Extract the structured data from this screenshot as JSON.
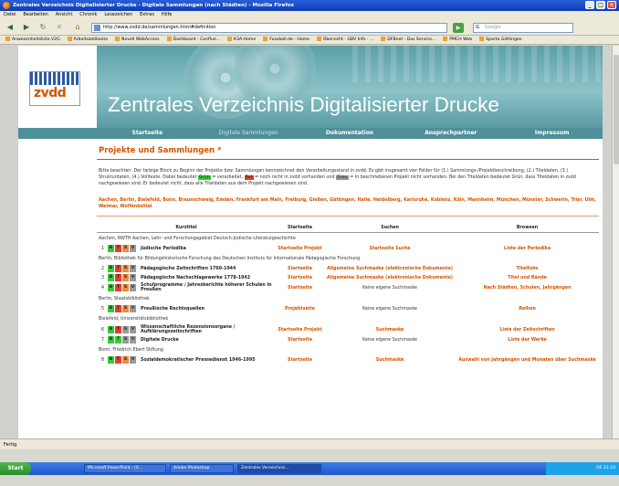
{
  "window": {
    "title": "Zentrales Verzeichnis Digitalisierter Drucke - Digitale Sammlungen (nach Städten) - Mozilla Firefox"
  },
  "menu": [
    "Datei",
    "Bearbeiten",
    "Ansicht",
    "Chronik",
    "Lesezeichen",
    "Extras",
    "Hilfe"
  ],
  "url": "http://www.zvdd.de/sammlungen.html#definition",
  "search_placeholder": "Google",
  "bookmarks": [
    "Anwesenheitsliste V2G",
    "Arbeitszeitkonto",
    "Novell WebAccess",
    "Dashboard - Conflue...",
    "K3A-Home",
    "Fussball.de - Home",
    "Übersicht - GBV Info - ...",
    "DFBnet - Das Service...",
    "PMCH Web",
    "Sparta Göttingen"
  ],
  "logo_text": "zvdd",
  "banner_title": "Zentrales Verzeichnis Digitalisierter Drucke",
  "sitenav": [
    "Startseite",
    "Digitale Sammlungen",
    "Dokumentation",
    "Ansprechpartner",
    "Impressum"
  ],
  "heading": "Projekte und Sammlungen *",
  "intro": {
    "p1": "Bitte beachten: Der farbige Block zu Beginn der Projekte bzw. Sammlungen kennzeichnet den Verarbeitungsstand in zvdd. Es gibt insgesamt vier Felder für (1.) Sammlungs-/Projektbeschreibung, (2.) Titeldaten, (3.) Strukturdaten, (4.) Volltexte. Dabei bedeutet ",
    "green": "Grün",
    "p2": " = verarbeitet, ",
    "red": "Rot",
    "p3": " = noch nicht in zvdd vorhanden und ",
    "gray": "Grau",
    "p4": " = in beschriebenen Projekt nicht vorhanden. Bei den Titeldaten bedeutet Grün, dass Titeldaten in zvdd nachgewiesen sind. Er bedeutet nicht, dass alle Titeldaten aus dem Projekt nachgewiesen sind."
  },
  "cities": "Aachen, Berlin, Bielefeld, Bonn, Braunschweig, Emden, Frankfurt am Main, Freiburg, Gießen, Göttingen, Halle, Heidelberg, Karlsruhe, Koblenz, Köln, Mannheim, München, Münster, Schwerin, Trier, Ulm, Weimar, Wolfenbüttel",
  "table": {
    "headers": [
      "Kurztitel",
      "Startseite",
      "Suchen",
      "Browsen"
    ],
    "groups": [
      {
        "label": "Aachen, RWTH Aachen, Lehr- und Forschungsgebiet Deutsch-Jüdische Literaturgeschichte",
        "rows": [
          {
            "n": "1",
            "flags": [
              "g",
              "r",
              "o",
              "gr"
            ],
            "title": "Jüdische Periodika",
            "start": "Startseite Projekt",
            "search": "Startseite Suche",
            "browse": "Liste der Periodika",
            "search_plain": false
          }
        ]
      },
      {
        "label": "Berlin, Bibliothek für Bildungshistorische Forschung des Deutschen Instituts für Internationale Pädagogische Forschung",
        "rows": [
          {
            "n": "2",
            "flags": [
              "g",
              "r",
              "o",
              "gr"
            ],
            "title": "Pädagogische Zeitschriften 1760-1944",
            "start": "Startseite",
            "search": "Allgemeine Suchmaske (elektronische Dokumente)",
            "browse": "Titelliste",
            "search_plain": false
          },
          {
            "n": "3",
            "flags": [
              "g",
              "r",
              "o",
              "gr"
            ],
            "title": "Pädagogische Nachschlagewerke 1778-1942",
            "start": "Startseite",
            "search": "Allgemeine Suchmaske (elektronische Dokumente)",
            "browse": "Titel und Bände",
            "search_plain": false
          },
          {
            "n": "4",
            "flags": [
              "g",
              "r",
              "o",
              "gr"
            ],
            "title": "Schulprogramme / Jahresberichte höherer Schulen in Preußen",
            "start": "Startseite",
            "search": "Keine eigene Suchmaske",
            "browse": "Nach Städten, Schulen, Jahrgängen",
            "search_plain": true
          }
        ]
      },
      {
        "label": "Berlin, Staatsbibliothek",
        "rows": [
          {
            "n": "5",
            "flags": [
              "g",
              "r",
              "o",
              "gr"
            ],
            "title": "Preußische Rechtsquellen",
            "start": "Projektseite",
            "search": "Keine eigene Suchmaske",
            "browse": "Reihen",
            "search_plain": true
          }
        ]
      },
      {
        "label": "Bielefeld, Universitätsbibliothek",
        "rows": [
          {
            "n": "6",
            "flags": [
              "g",
              "r",
              "gr",
              "gr"
            ],
            "title": "Wissenschaftliche Rezensionsorgane / Aufklärungszeitschriften",
            "start": "Startseite Projekt",
            "search": "Suchmaske",
            "browse": "Liste der Zeitschriften",
            "search_plain": false
          },
          {
            "n": "7",
            "flags": [
              "g",
              "g",
              "gr",
              "gr"
            ],
            "title": "Digitale Drucke",
            "start": "Startseite",
            "search": "Keine eigene Suchmaske",
            "browse": "Liste der Werke",
            "search_plain": true
          }
        ]
      },
      {
        "label": "Bonn, Friedrich Ebert Stiftung",
        "rows": [
          {
            "n": "8",
            "flags": [
              "g",
              "r",
              "o",
              "gr"
            ],
            "title": "Sozialdemokratischer Pressedienst 1946-1995",
            "start": "Startseite",
            "search": "Suchmaske",
            "browse": "Auswahl von Jahrgängen und Monaten über Suchmaske",
            "search_plain": false
          }
        ]
      }
    ]
  },
  "status": "Fertig",
  "taskbar": {
    "start": "Start",
    "tasks": [
      "Microsoft PowerPoint - [S...",
      "Adobe Photoshop",
      "Zentrales Verzeichnis..."
    ],
    "clock": "DE  21:10"
  },
  "colors": {
    "accent": "#d35400",
    "banner": "#5b9fa7",
    "nav": "#4f8f98"
  }
}
